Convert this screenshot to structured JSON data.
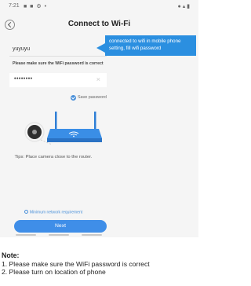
{
  "status_bar": {
    "time": "7:21",
    "left_icons": "■ ■ ⚙ •",
    "right_icons": "● ▴ ▮"
  },
  "nav": {
    "title": "Connect to Wi-Fi"
  },
  "tooltip": {
    "text": "connected to wifi in mobile phone setting, fill wifi password"
  },
  "wifi": {
    "name": "yuyuyu"
  },
  "password_note": "Please make sure the WiFi password is correct",
  "password": {
    "value": "••••••••",
    "clear_glyph": "×"
  },
  "save_password_label": "Save password",
  "tips": "Tips: Place camera close to the router.",
  "min_requirement": "Minimum network requirement",
  "next_label": "Next",
  "note": {
    "title": "Note:",
    "lines": [
      "1. Please make sure the WiFi password is correct",
      "2. Please turn on location of phone"
    ]
  },
  "colors": {
    "accent": "#3f8ee8",
    "tooltip": "#2b8fe0",
    "background": "#f5f5f5"
  }
}
